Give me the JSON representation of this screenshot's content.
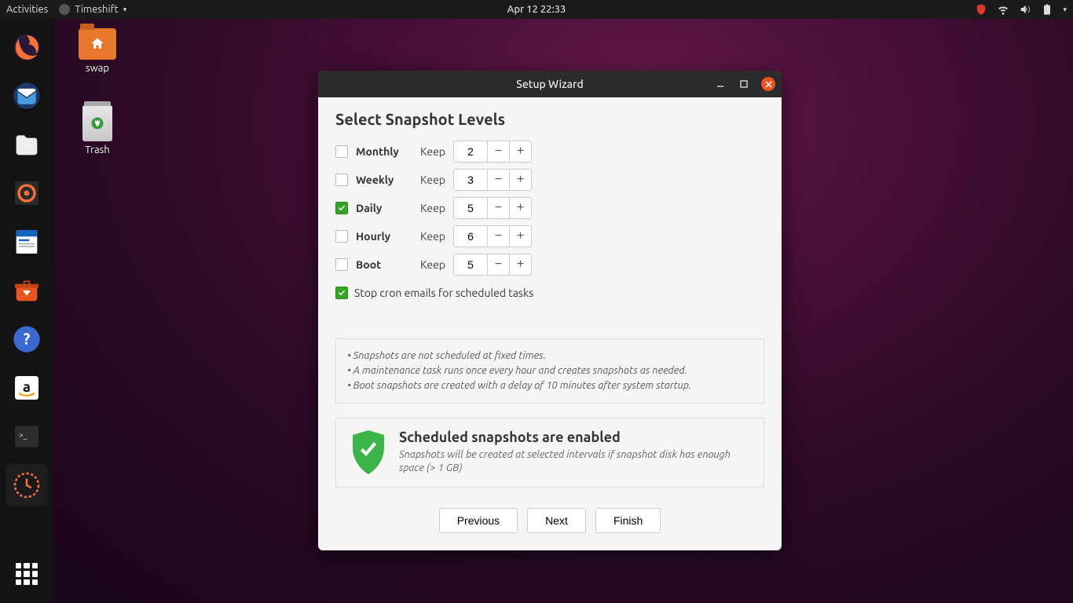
{
  "topbar": {
    "activities": "Activities",
    "app_name": "Timeshift",
    "clock": "Apr 12  22:33"
  },
  "desktop": {
    "swap": "swap",
    "trash": "Trash"
  },
  "window": {
    "title": "Setup Wizard",
    "heading": "Select Snapshot Levels",
    "keep_label": "Keep",
    "levels": [
      {
        "label": "Monthly",
        "value": "2",
        "checked": false
      },
      {
        "label": "Weekly",
        "value": "3",
        "checked": false
      },
      {
        "label": "Daily",
        "value": "5",
        "checked": true
      },
      {
        "label": "Hourly",
        "value": "6",
        "checked": false
      },
      {
        "label": "Boot",
        "value": "5",
        "checked": false
      }
    ],
    "cron_label": "Stop cron emails for scheduled tasks",
    "cron_checked": true,
    "notes": [
      "• Snapshots are not scheduled at fixed times.",
      "• A maintenance task runs once every hour and creates snapshots as needed.",
      "• Boot snapshots are created with a delay of 10 minutes after system startup."
    ],
    "status_title": "Scheduled snapshots are enabled",
    "status_sub": "Snapshots will be created at selected intervals if snapshot disk has enough space (> 1 GB)",
    "btn_prev": "Previous",
    "btn_next": "Next",
    "btn_finish": "Finish"
  }
}
